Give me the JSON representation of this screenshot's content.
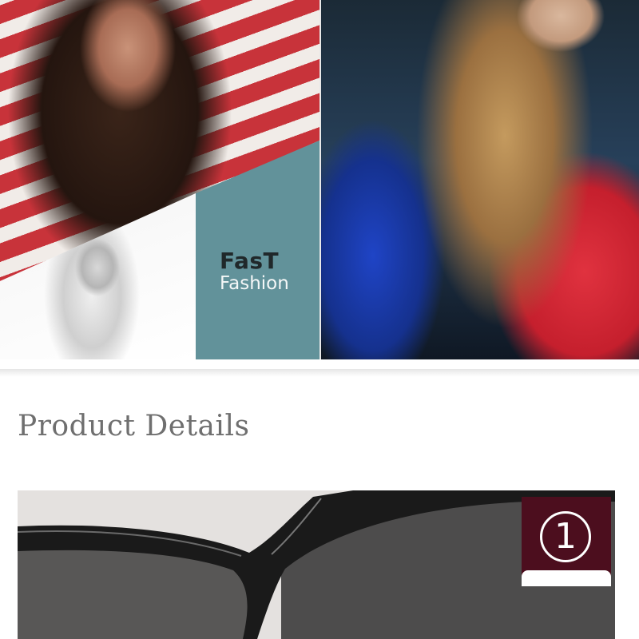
{
  "banner": {
    "tagline_line1": "FasT",
    "tagline_line2": "Fashion"
  },
  "section": {
    "title": "Product Details"
  },
  "detail_badge": {
    "number": "1"
  },
  "colors": {
    "teal_card": "#62929a",
    "badge": "#4c0e1e",
    "title_text": "#6f6f6f"
  }
}
